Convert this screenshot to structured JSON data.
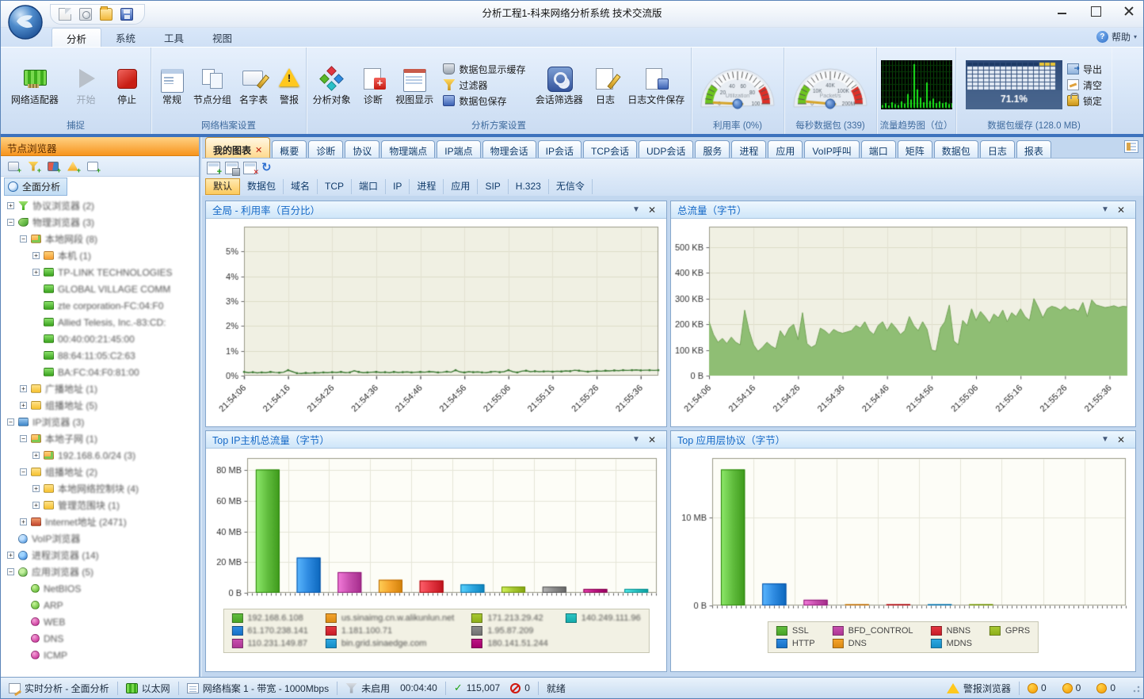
{
  "window": {
    "title": "分析工程1-科来网络分析系统 技术交流版"
  },
  "ribbon": {
    "tabs": [
      "分析",
      "系统",
      "工具",
      "视图"
    ],
    "help": "帮助",
    "groups": {
      "capture": {
        "label": "捕捉",
        "adapter": "网络适配器",
        "start": "开始",
        "stop": "停止"
      },
      "profile": {
        "label": "网络档案设置",
        "general": "常规",
        "node_group": "节点分组",
        "name_table": "名字表",
        "alarm": "警报"
      },
      "analysis": {
        "label": "分析方案设置",
        "object": "分析对象",
        "diagnosis": "诊断",
        "view_display": "视图显示",
        "packet_display_buffer": "数据包显示缓存",
        "filter": "过滤器",
        "packet_save": "数据包保存",
        "session_filter": "会话筛选器",
        "log": "日志",
        "log_save": "日志文件保存"
      },
      "gauge_util": {
        "label": "利用率 (0%)",
        "center": "Utilization",
        "ticks": [
          "0",
          "20",
          "40",
          "60",
          "80",
          "100"
        ],
        "value_frac": 0.015
      },
      "gauge_pps": {
        "label": "每秒数据包 (339)",
        "center": "Packet/s",
        "ticks": [
          "0",
          "10K",
          "40K",
          "100K",
          "200M"
        ],
        "value_frac": 0.03
      },
      "trend": {
        "label": "流量趋势图（位）",
        "bars": [
          0.06,
          0.1,
          0.05,
          0.12,
          0.08,
          0.06,
          0.14,
          0.09,
          0.3,
          0.18,
          0.95,
          0.4,
          0.22,
          0.12,
          0.55,
          0.15,
          0.2,
          0.1,
          0.14,
          0.1,
          0.12,
          0.08,
          0.1
        ]
      },
      "buffer": {
        "label": "数据包缓存 (128.0 MB)",
        "percent": "71.1%",
        "export": "导出",
        "clear": "清空",
        "lock": "锁定"
      }
    }
  },
  "sidebar": {
    "header": "节点浏览器",
    "scope": "全面分析",
    "tree": [
      {
        "label": "协议浏览器 (2)",
        "depth": 0,
        "expand": "+",
        "icon": "i-funnel"
      },
      {
        "label": "物理浏览器 (3)",
        "depth": 0,
        "expand": "-",
        "icon": "i-leaf"
      },
      {
        "label": "本地网段 (8)",
        "depth": 1,
        "expand": "-",
        "icon": "i-seg"
      },
      {
        "label": "本机 (1)",
        "depth": 2,
        "expand": "+",
        "icon": "i-host"
      },
      {
        "label": "TP-LINK TECHNOLOGIES",
        "depth": 2,
        "expand": "+",
        "icon": "i-nic"
      },
      {
        "label": "GLOBAL VILLAGE COMM",
        "depth": 2,
        "expand": "",
        "icon": "i-nic"
      },
      {
        "label": "zte corporation-FC:04:F0",
        "depth": 2,
        "expand": "",
        "icon": "i-nic"
      },
      {
        "label": "Allied Telesis, Inc.-83:CD:",
        "depth": 2,
        "expand": "",
        "icon": "i-nic"
      },
      {
        "label": "00:40:00:21:45:00",
        "depth": 2,
        "expand": "",
        "icon": "i-nic"
      },
      {
        "label": "88:64:11:05:C2:63",
        "depth": 2,
        "expand": "",
        "icon": "i-nic"
      },
      {
        "label": "BA:FC:04:F0:81:00",
        "depth": 2,
        "expand": "",
        "icon": "i-nic"
      },
      {
        "label": "广播地址 (1)",
        "depth": 1,
        "expand": "+",
        "icon": "i-addr"
      },
      {
        "label": "组播地址 (5)",
        "depth": 1,
        "expand": "+",
        "icon": "i-addr"
      },
      {
        "label": "IP浏览器 (3)",
        "depth": 0,
        "expand": "-",
        "icon": "i-ip"
      },
      {
        "label": "本地子网 (1)",
        "depth": 1,
        "expand": "-",
        "icon": "i-seg"
      },
      {
        "label": "192.168.6.0/24 (3)",
        "depth": 2,
        "expand": "+",
        "icon": "i-seg"
      },
      {
        "label": "组播地址 (2)",
        "depth": 1,
        "expand": "-",
        "icon": "i-addr"
      },
      {
        "label": "本地网络控制块 (4)",
        "depth": 2,
        "expand": "+",
        "icon": "i-addr"
      },
      {
        "label": "管理范围块 (1)",
        "depth": 2,
        "expand": "+",
        "icon": "i-addr"
      },
      {
        "label": "Internet地址 (2471)",
        "depth": 1,
        "expand": "+",
        "icon": "i-globe"
      },
      {
        "label": "VoIP浏览器",
        "depth": 0,
        "expand": "",
        "icon": "i-voip"
      },
      {
        "label": "进程浏览器 (14)",
        "depth": 0,
        "expand": "+",
        "icon": "i-proc"
      },
      {
        "label": "应用浏览器 (5)",
        "depth": 0,
        "expand": "-",
        "icon": "i-app"
      },
      {
        "label": "NetBIOS",
        "depth": 1,
        "expand": "",
        "icon": "i-dotg"
      },
      {
        "label": "ARP",
        "depth": 1,
        "expand": "",
        "icon": "i-dotg"
      },
      {
        "label": "WEB",
        "depth": 1,
        "expand": "",
        "icon": "i-dotm"
      },
      {
        "label": "DNS",
        "depth": 1,
        "expand": "",
        "icon": "i-dotm"
      },
      {
        "label": "ICMP",
        "depth": 1,
        "expand": "",
        "icon": "i-dotm"
      }
    ]
  },
  "content": {
    "tabs": [
      {
        "label": "我的图表",
        "active": true,
        "closable": true
      },
      {
        "label": "概要"
      },
      {
        "label": "诊断"
      },
      {
        "label": "协议"
      },
      {
        "label": "物理端点"
      },
      {
        "label": "IP端点"
      },
      {
        "label": "物理会话"
      },
      {
        "label": "IP会话"
      },
      {
        "label": "TCP会话"
      },
      {
        "label": "UDP会话"
      },
      {
        "label": "服务"
      },
      {
        "label": "进程"
      },
      {
        "label": "应用"
      },
      {
        "label": "VoIP呼叫"
      },
      {
        "label": "端口"
      },
      {
        "label": "矩阵"
      },
      {
        "label": "数据包"
      },
      {
        "label": "日志"
      },
      {
        "label": "报表"
      }
    ],
    "chips": [
      {
        "label": "默认",
        "active": true
      },
      {
        "label": "数据包"
      },
      {
        "label": "域名"
      },
      {
        "label": "TCP"
      },
      {
        "label": "端口"
      },
      {
        "label": "IP"
      },
      {
        "label": "进程"
      },
      {
        "label": "应用"
      },
      {
        "label": "SIP"
      },
      {
        "label": "H.323"
      },
      {
        "label": "无信令"
      }
    ]
  },
  "chart_data": [
    {
      "type": "line",
      "title": "全局 - 利用率（百分比）",
      "ylim": [
        0,
        6
      ],
      "ytick_values": [
        0,
        1,
        2,
        3,
        4,
        5
      ],
      "ytick_labels": [
        "0%",
        "1%",
        "2%",
        "3%",
        "4%",
        "5%"
      ],
      "x_labels": [
        "21:54:06",
        "21:54:16",
        "21:54:26",
        "21:54:36",
        "21:54:46",
        "21:54:56",
        "21:55:06",
        "21:55:16",
        "21:55:26",
        "21:55:36"
      ],
      "line_color": "#3e7a35",
      "plot_bg": "#f0f0e3",
      "values": [
        0.15,
        0.12,
        0.14,
        0.11,
        0.13,
        0.12,
        0.15,
        0.13,
        0.12,
        0.14,
        0.22,
        0.16,
        0.1,
        0.09,
        0.11,
        0.1,
        0.12,
        0.11,
        0.13,
        0.12,
        0.14,
        0.13,
        0.15,
        0.12,
        0.13,
        0.2,
        0.15,
        0.12,
        0.13,
        0.14,
        0.15,
        0.13,
        0.14,
        0.12,
        0.15,
        0.13,
        0.14,
        0.15,
        0.13,
        0.14,
        0.15,
        0.14,
        0.16,
        0.15,
        0.13,
        0.14,
        0.16,
        0.14,
        0.22,
        0.15,
        0.13,
        0.16,
        0.14,
        0.15,
        0.13,
        0.12,
        0.15,
        0.17,
        0.14,
        0.16,
        0.22,
        0.16,
        0.13,
        0.18,
        0.2,
        0.16,
        0.18,
        0.16,
        0.17,
        0.18,
        0.16,
        0.18,
        0.17,
        0.19,
        0.18,
        0.22,
        0.2,
        0.18,
        0.16,
        0.18,
        0.19,
        0.18,
        0.2,
        0.19,
        0.21,
        0.2,
        0.22,
        0.21,
        0.22,
        0.23,
        0.21,
        0.22,
        0.22,
        0.21,
        0.22
      ]
    },
    {
      "type": "area",
      "title": "总流量（字节）",
      "ylim": [
        0,
        580
      ],
      "ytick_values": [
        0,
        100,
        200,
        300,
        400,
        500
      ],
      "ytick_labels": [
        "0 B",
        "100 KB",
        "200 KB",
        "300 KB",
        "400 KB",
        "500 KB"
      ],
      "x_labels": [
        "21:54:06",
        "21:54:16",
        "21:54:26",
        "21:54:36",
        "21:54:46",
        "21:54:56",
        "21:55:06",
        "21:55:16",
        "21:55:26",
        "21:55:36"
      ],
      "line_color": "#74a457",
      "fill_color": "#8fbe74",
      "plot_bg": "#f0f0e3",
      "values": [
        210,
        160,
        130,
        145,
        125,
        150,
        130,
        120,
        255,
        175,
        120,
        95,
        110,
        130,
        115,
        105,
        175,
        150,
        185,
        200,
        140,
        245,
        125,
        110,
        120,
        185,
        175,
        160,
        180,
        170,
        165,
        170,
        175,
        195,
        185,
        210,
        175,
        160,
        195,
        210,
        175,
        205,
        185,
        160,
        175,
        230,
        195,
        175,
        210,
        180,
        100,
        95,
        185,
        210,
        275,
        135,
        120,
        215,
        195,
        260,
        215,
        250,
        230,
        205,
        240,
        225,
        255,
        210,
        245,
        230,
        260,
        230,
        215,
        300,
        265,
        225,
        260,
        270,
        265,
        255,
        270,
        255,
        260,
        250,
        285,
        230,
        295,
        275,
        270,
        265,
        268,
        272,
        265,
        270,
        268
      ]
    },
    {
      "type": "bar",
      "title": "Top IP主机总流量（字节）",
      "ylim": [
        0,
        88
      ],
      "ytick_values": [
        0,
        20,
        40,
        60,
        80
      ],
      "ytick_labels": [
        "0 B",
        "20 MB",
        "40 MB",
        "60 MB",
        "80 MB"
      ],
      "slots": 10,
      "legend_rows": 3,
      "legend_blurred": true,
      "items": [
        {
          "name": "192.168.6.108",
          "value": 80.5,
          "color": "#61bd3e"
        },
        {
          "name": "61.170.238.141",
          "value": 23,
          "color": "#2e8ae0"
        },
        {
          "name": "110.231.149.87",
          "value": 13.5,
          "color": "#c74fae"
        },
        {
          "name": "us.sinaimg.cn.w.alikunlun.net",
          "value": 8.5,
          "color": "#f4a32c"
        },
        {
          "name": "1.181.100.71",
          "value": 8,
          "color": "#e23540"
        },
        {
          "name": "bin.grid.sinaedge.com",
          "value": 5.5,
          "color": "#2ea7e0"
        },
        {
          "name": "171.213.29.42",
          "value": 4,
          "color": "#a7c832"
        },
        {
          "name": "1.95.87.209",
          "value": 4,
          "color": "#8a8a8a"
        },
        {
          "name": "180.141.51.244",
          "value": 2.5,
          "color": "#bc1684"
        },
        {
          "name": "140.249.111.96",
          "value": 2.5,
          "color": "#2cc4c4"
        }
      ]
    },
    {
      "type": "bar",
      "title": "Top 应用层协议（字节）",
      "ylim": [
        0,
        16.8
      ],
      "ytick_values": [
        0,
        10
      ],
      "ytick_labels": [
        "0 B",
        "10 MB"
      ],
      "slots": 10,
      "legend_rows": 2,
      "legend_blurred": false,
      "items": [
        {
          "name": "SSL",
          "value": 15.5,
          "color": "#61bd3e"
        },
        {
          "name": "HTTP",
          "value": 2.5,
          "color": "#2e8ae0"
        },
        {
          "name": "BFD_CONTROL",
          "value": 0.65,
          "color": "#c74fae"
        },
        {
          "name": "DNS",
          "value": 0.12,
          "color": "#f4a32c"
        },
        {
          "name": "NBNS",
          "value": 0.04,
          "color": "#e23540"
        },
        {
          "name": "MDNS",
          "value": 0.03,
          "color": "#2ea7e0"
        },
        {
          "name": "GPRS",
          "value": 0.02,
          "color": "#a7c832"
        }
      ]
    }
  ],
  "statusbar": {
    "mode": "实时分析 - 全面分析",
    "adapter": "以太网",
    "profile": "网络档案 1 - 带宽 - 1000Mbps",
    "filter_state": "未启用",
    "duration": "00:04:40",
    "accepted": "115,007",
    "rejected": "0",
    "ready": "就绪",
    "alarm_label": "警报浏览器",
    "alarm_counts": [
      "0",
      "0",
      "0"
    ]
  }
}
